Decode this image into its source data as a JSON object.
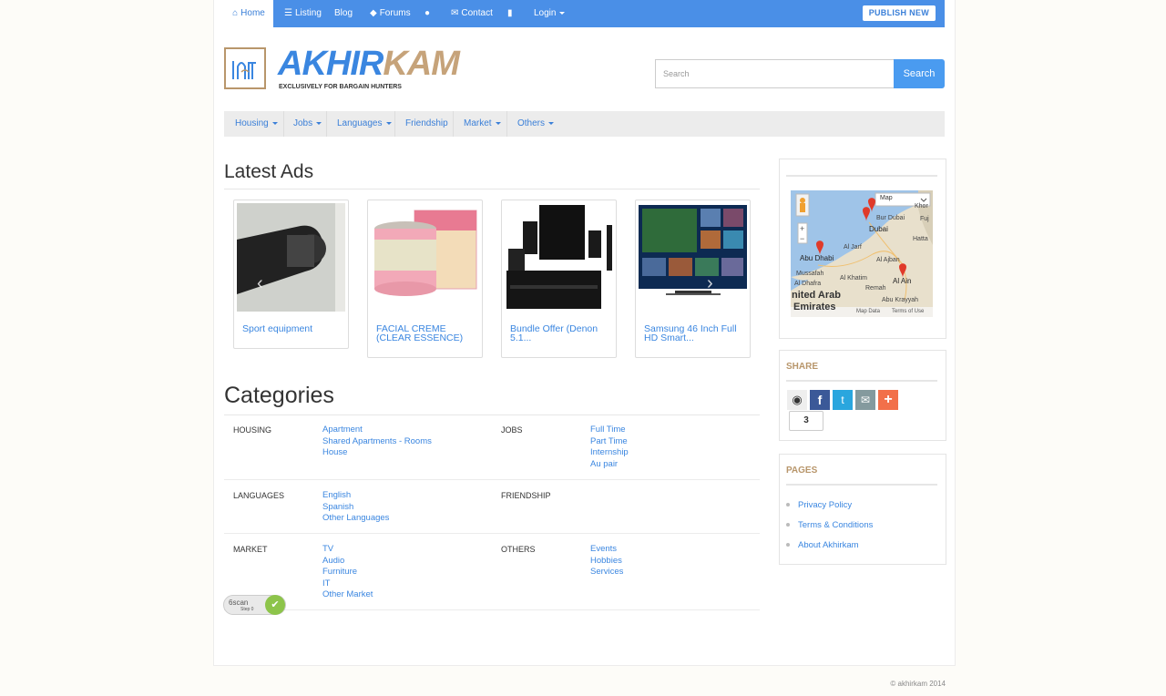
{
  "topnav": {
    "items": [
      {
        "label": "Home",
        "icon": "home-icon"
      },
      {
        "label": "Listing",
        "icon": "list-icon"
      },
      {
        "label": "Blog"
      },
      {
        "label": "Forums",
        "icon": "tag-icon"
      },
      {
        "label": "",
        "icon": "globe-icon"
      },
      {
        "label": "Contact",
        "icon": "envelope-icon"
      },
      {
        "label": "",
        "icon": "signal-icon"
      },
      {
        "label": "Login"
      }
    ],
    "publish_label": "PUBLISH NEW"
  },
  "logo": {
    "part1": "AKHIR",
    "part2": "KAM",
    "tagline": "EXCLUSIVELY FOR BARGAIN HUNTERS"
  },
  "search": {
    "placeholder": "Search",
    "button": "Search"
  },
  "catnav": [
    "Housing",
    "Jobs",
    "Languages",
    "Friendship",
    "Market",
    "Others"
  ],
  "latest": {
    "title": "Latest Ads",
    "ads": [
      {
        "title": "Sport equipment"
      },
      {
        "title": "FACIAL CREME (CLEAR ESSENCE)"
      },
      {
        "title": "Bundle Offer (Denon 5.1..."
      },
      {
        "title": "Samsung 46 Inch Full HD Smart..."
      }
    ]
  },
  "categories": {
    "title": "Categories",
    "groups": [
      {
        "name": "HOUSING",
        "links": [
          "Apartment",
          "Shared Apartments - Rooms",
          "House"
        ]
      },
      {
        "name": "JOBS",
        "links": [
          "Full Time",
          "Part Time",
          "Internship",
          "Au pair"
        ]
      },
      {
        "name": "LANGUAGES",
        "links": [
          "English",
          "Spanish",
          "Other Languages"
        ]
      },
      {
        "name": "FRIENDSHIP",
        "links": []
      },
      {
        "name": "MARKET",
        "links": [
          "TV",
          "Audio",
          "Furniture",
          "IT",
          "Other Market"
        ]
      },
      {
        "name": "OTHERS",
        "links": [
          "Events",
          "Hobbies",
          "Services"
        ]
      }
    ]
  },
  "map": {
    "type_label": "Map",
    "places": [
      "Bur Dubai",
      "Dubai",
      "Al Jarf",
      "Abu Dhabi",
      "Al Ajban",
      "Mussafah",
      "Al Khatim",
      "Al Ain",
      "Al Dhafra",
      "Remah",
      "Abu Krayyah",
      "nited Arab",
      "Emirates",
      "Hatta",
      "Khor",
      "Fuj"
    ],
    "data_label": "Map Data",
    "terms_label": "Terms of Use"
  },
  "share": {
    "title": "SHARE",
    "count": "3"
  },
  "pages": {
    "title": "PAGES",
    "links": [
      "Privacy Policy",
      "Terms & Conditions",
      "About Akhirkam"
    ]
  },
  "footer": {
    "copyright": "© akhirkam 2014"
  },
  "badge": {
    "label": "6scan",
    "sublabel": "Step 0"
  },
  "colors": {
    "accent": "#4a8fe7",
    "brand_gold": "#b8966b",
    "link": "#3a86e0"
  }
}
